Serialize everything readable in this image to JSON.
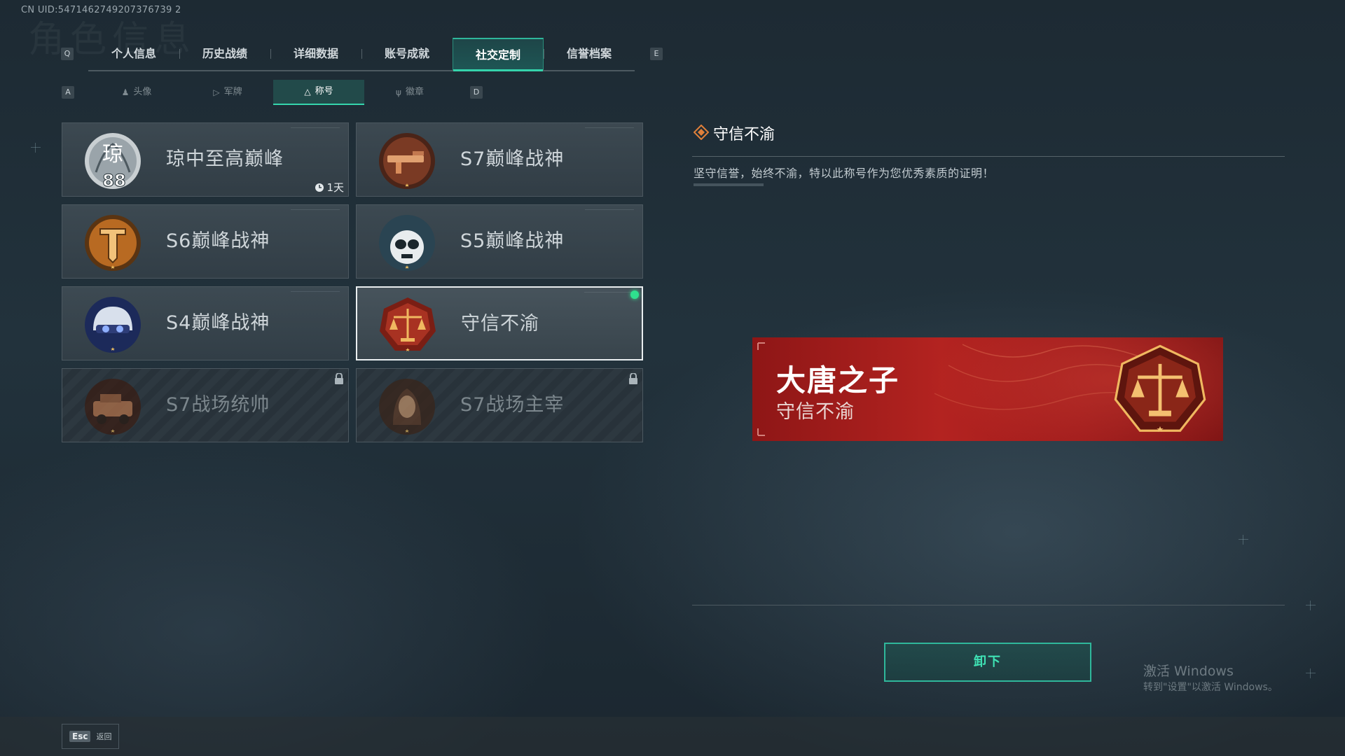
{
  "uid": "CN UID:5471462749207376739 2",
  "ghost_title": "角色信息",
  "keys": {
    "top_left": "Q",
    "top_right": "E",
    "sub_left": "A",
    "sub_right": "D"
  },
  "top_tabs": [
    {
      "label": "个人信息"
    },
    {
      "label": "历史战绩"
    },
    {
      "label": "详细数据"
    },
    {
      "label": "账号成就"
    },
    {
      "label": "社交定制"
    },
    {
      "label": "信誉档案"
    }
  ],
  "active_top_tab": "社交定制",
  "sub_tabs": [
    {
      "label": "头像",
      "icon": "person-icon"
    },
    {
      "label": "军牌",
      "icon": "dogtag-icon"
    },
    {
      "label": "称号",
      "icon": "title-icon"
    },
    {
      "label": "徽章",
      "icon": "badge-icon"
    }
  ],
  "active_sub_tab": "称号",
  "titles": [
    {
      "name": "琼中至高巅峰",
      "emblem": "hainan-88-emblem",
      "timer": "1天"
    },
    {
      "name": "S7巅峰战神",
      "emblem": "s7-gun-emblem"
    },
    {
      "name": "S6巅峰战神",
      "emblem": "s6-shield-emblem"
    },
    {
      "name": "S5巅峰战神",
      "emblem": "s5-skull-emblem"
    },
    {
      "name": "S4巅峰战神",
      "emblem": "s4-helmet-emblem"
    },
    {
      "name": "守信不渝",
      "emblem": "scales-emblem",
      "selected": true,
      "equipped": true
    },
    {
      "name": "S7战场统帅",
      "emblem": "s7-vehicle-emblem",
      "locked": true
    },
    {
      "name": "S7战场主宰",
      "emblem": "s7-warrior-emblem",
      "locked": true
    }
  ],
  "detail": {
    "title": "守信不渝",
    "description": "坚守信誉，始终不渝，特以此称号作为您优秀素质的证明！"
  },
  "banner": {
    "player_name": "大唐之子",
    "title": "守信不渝",
    "colors": {
      "primary": "#a81e1c",
      "dark": "#7e1414"
    }
  },
  "unequip_label": "卸下",
  "windows_watermark": {
    "line1": "激活 Windows",
    "line2": "转到\"设置\"以激活 Windows。"
  },
  "footer": {
    "esc_key": "Esc",
    "esc_label": "返回"
  },
  "colors": {
    "accent": "#35d4ac",
    "equipped_dot": "#2fe08e"
  }
}
